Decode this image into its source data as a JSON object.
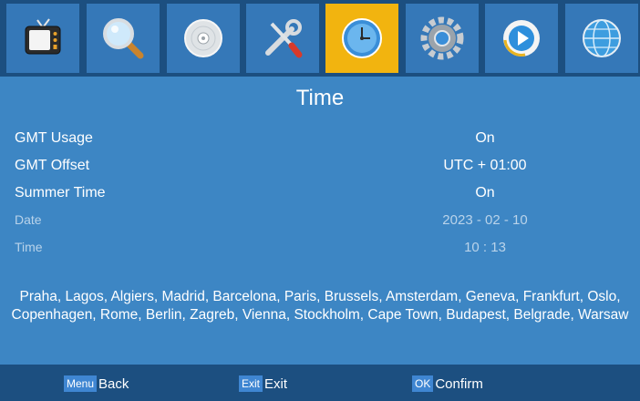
{
  "colors": {
    "active_tab": "#f2b40f",
    "background": "#3d86c4",
    "bar": "#1c4f80"
  },
  "menu_icons": [
    "tv-icon",
    "search-icon",
    "disc-icon",
    "tools-icon",
    "clock-icon",
    "gear-icon",
    "media-play-icon",
    "globe-icon"
  ],
  "active_tab": "clock-icon",
  "page": {
    "title": "Time"
  },
  "settings": [
    {
      "label": "GMT Usage",
      "value": "On"
    },
    {
      "label": "GMT Offset",
      "value": "UTC + 01:00"
    },
    {
      "label": "Summer Time",
      "value": "On"
    },
    {
      "label": "Date",
      "value": "2023  - 02 - 10"
    },
    {
      "label": "Time",
      "value": "10 : 13"
    }
  ],
  "cities": {
    "line1": "Praha, Lagos, Algiers, Madrid, Barcelona, Paris, Brussels, Amsterdam, Geneva, Frankfurt, Oslo,",
    "line2": "Copenhagen, Rome, Berlin, Zagreb, Vienna, Stockholm, Cape Town, Budapest, Belgrade, Warsaw"
  },
  "footer": {
    "back": {
      "key": "Menu",
      "label": "Back"
    },
    "exit": {
      "key": "Exit",
      "label": "Exit"
    },
    "confirm": {
      "key": "OK",
      "label": "Confirm"
    }
  }
}
